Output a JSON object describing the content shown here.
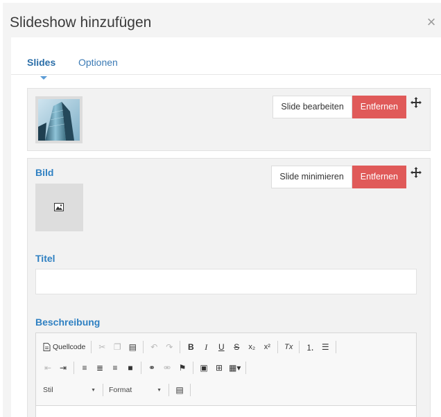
{
  "modal": {
    "title": "Slideshow hinzufügen",
    "close_symbol": "×"
  },
  "tabs": [
    {
      "label": "Slides",
      "active": true
    },
    {
      "label": "Optionen",
      "active": false
    }
  ],
  "slides": {
    "collapsed": {
      "edit_label": "Slide bearbeiten",
      "remove_label": "Entfernen"
    },
    "expanded": {
      "minimize_label": "Slide minimieren",
      "remove_label": "Entfernen",
      "image_label": "Bild",
      "title_label": "Titel",
      "title_value": "",
      "description_label": "Beschreibung"
    }
  },
  "editor": {
    "source_label": "Quellcode",
    "style_label": "Stil",
    "format_label": "Format",
    "bold": "B",
    "italic": "I",
    "underline": "U",
    "strike": "S",
    "subscript": "x₂",
    "superscript": "x²",
    "remove_format": "Tx"
  },
  "colors": {
    "accent": "#2f80c2",
    "danger": "#e05a59",
    "modal_bg": "#f4f4f4",
    "card_bg": "#f2f2f2"
  },
  "icons": [
    "close-icon",
    "move-icon",
    "image-icon",
    "source-icon",
    "cut-icon",
    "copy-icon",
    "paste-icon",
    "undo-icon",
    "redo-icon",
    "numbered-list-icon",
    "bullet-list-icon",
    "outdent-icon",
    "indent-icon",
    "align-left-icon",
    "align-center-icon",
    "align-right-icon",
    "justify-icon",
    "link-icon",
    "unlink-icon",
    "anchor-icon",
    "table-icon",
    "special-insert-icon",
    "templates-icon"
  ]
}
